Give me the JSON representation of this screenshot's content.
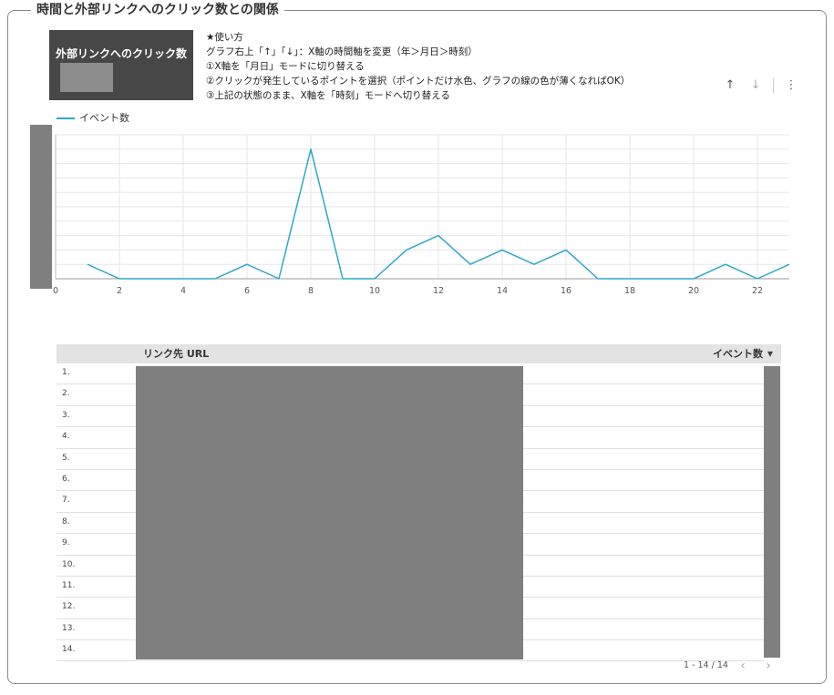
{
  "panel": {
    "title": "時間と外部リンクへのクリック数との関係"
  },
  "scorecard": {
    "label": "外部リンクへのクリック数"
  },
  "instructions": {
    "lines": [
      "★使い方",
      "グラフ右上「↑」「↓」：X軸の時間軸を変更（年＞月日＞時刻）",
      "①X軸を「月日」モードに切り替える",
      "②クリックが発生しているポイントを選択（ポイントだけ水色、グラフの線の色が薄くなればOK）",
      "③上記の状態のまま、X軸を「時刻」モードへ切り替える"
    ]
  },
  "toolbar": {
    "up_icon": "↑",
    "down_icon": "↓",
    "more_icon": "⋮"
  },
  "chart_data": {
    "type": "line",
    "x": [
      1,
      2,
      3,
      4,
      5,
      6,
      7,
      8,
      9,
      10,
      11,
      12,
      13,
      14,
      15,
      16,
      17,
      18,
      19,
      20,
      21,
      22,
      23
    ],
    "series": [
      {
        "name": "イベント数",
        "values": [
          1,
          0,
          0,
          0,
          0,
          1,
          0,
          9,
          0,
          0,
          2,
          3,
          1,
          2,
          1,
          2,
          0,
          0,
          0,
          0,
          1,
          0,
          1
        ],
        "color": "#2ba9c8"
      }
    ],
    "xlim": [
      0,
      23
    ],
    "ylim": [
      0,
      10
    ],
    "x_ticks": [
      "0",
      "2",
      "4",
      "6",
      "8",
      "10",
      "12",
      "14",
      "16",
      "18",
      "20",
      "22"
    ],
    "grid": true,
    "legend": "top-left"
  },
  "table": {
    "columns": [
      "リンク先 URL",
      "イベント数"
    ],
    "sort_icon": "▼",
    "row_numbers": [
      "1.",
      "2.",
      "3.",
      "4.",
      "5.",
      "6.",
      "7.",
      "8.",
      "9.",
      "10.",
      "11.",
      "12.",
      "13.",
      "14."
    ]
  },
  "pagination": {
    "label": "1 - 14 / 14",
    "prev_icon": "‹",
    "next_icon": "›"
  }
}
